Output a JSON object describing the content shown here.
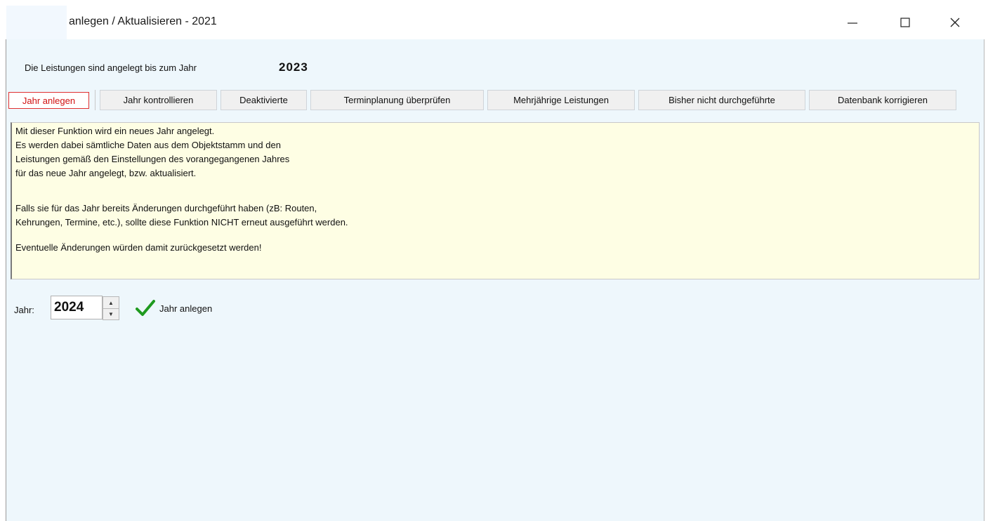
{
  "window": {
    "title": "anlegen / Aktualisieren - 2021",
    "minimize_glyph": "—",
    "maximize_glyph": "☐",
    "close_glyph": "✕"
  },
  "status": {
    "label": "Die Leistungen sind angelegt bis zum Jahr",
    "year": "2023"
  },
  "tabs": [
    {
      "label": "Jahr anlegen",
      "active": true
    },
    {
      "label": "Jahr kontrollieren",
      "active": false
    },
    {
      "label": "Deaktivierte",
      "active": false
    },
    {
      "label": "Terminplanung überprüfen",
      "active": false
    },
    {
      "label": "Mehrjährige Leistungen",
      "active": false
    },
    {
      "label": "Bisher nicht durchgeführte",
      "active": false
    },
    {
      "label": "Datenbank korrigieren",
      "active": false
    }
  ],
  "info_text": [
    "Mit dieser Funktion wird ein neues Jahr angelegt.",
    "Es werden dabei sämtliche Daten aus dem Objektstamm und den",
    "Leistungen gemäß den Einstellungen des vorangegangenen Jahres",
    "für das neue Jahr angelegt, bzw. aktualisiert.",
    "",
    "Falls sie für das Jahr bereits Änderungen durchgeführt haben (zB: Routen,",
    "Kehrungen, Termine, etc.),  sollte diese Funktion NICHT erneut ausgeführt werden.",
    "",
    "Eventuelle Änderungen würden damit zurückgesetzt werden!"
  ],
  "year_input": {
    "label": "Jahr:",
    "value": "2024",
    "up_glyph": "▲",
    "down_glyph": "▼"
  },
  "create_button": {
    "label": "Jahr anlegen",
    "icon": "checkmark-icon"
  },
  "colors": {
    "active_tab_text": "#d01010",
    "info_background": "#fefee4",
    "client_background": "#eef7fc",
    "checkmark": "#1f9a1f"
  }
}
